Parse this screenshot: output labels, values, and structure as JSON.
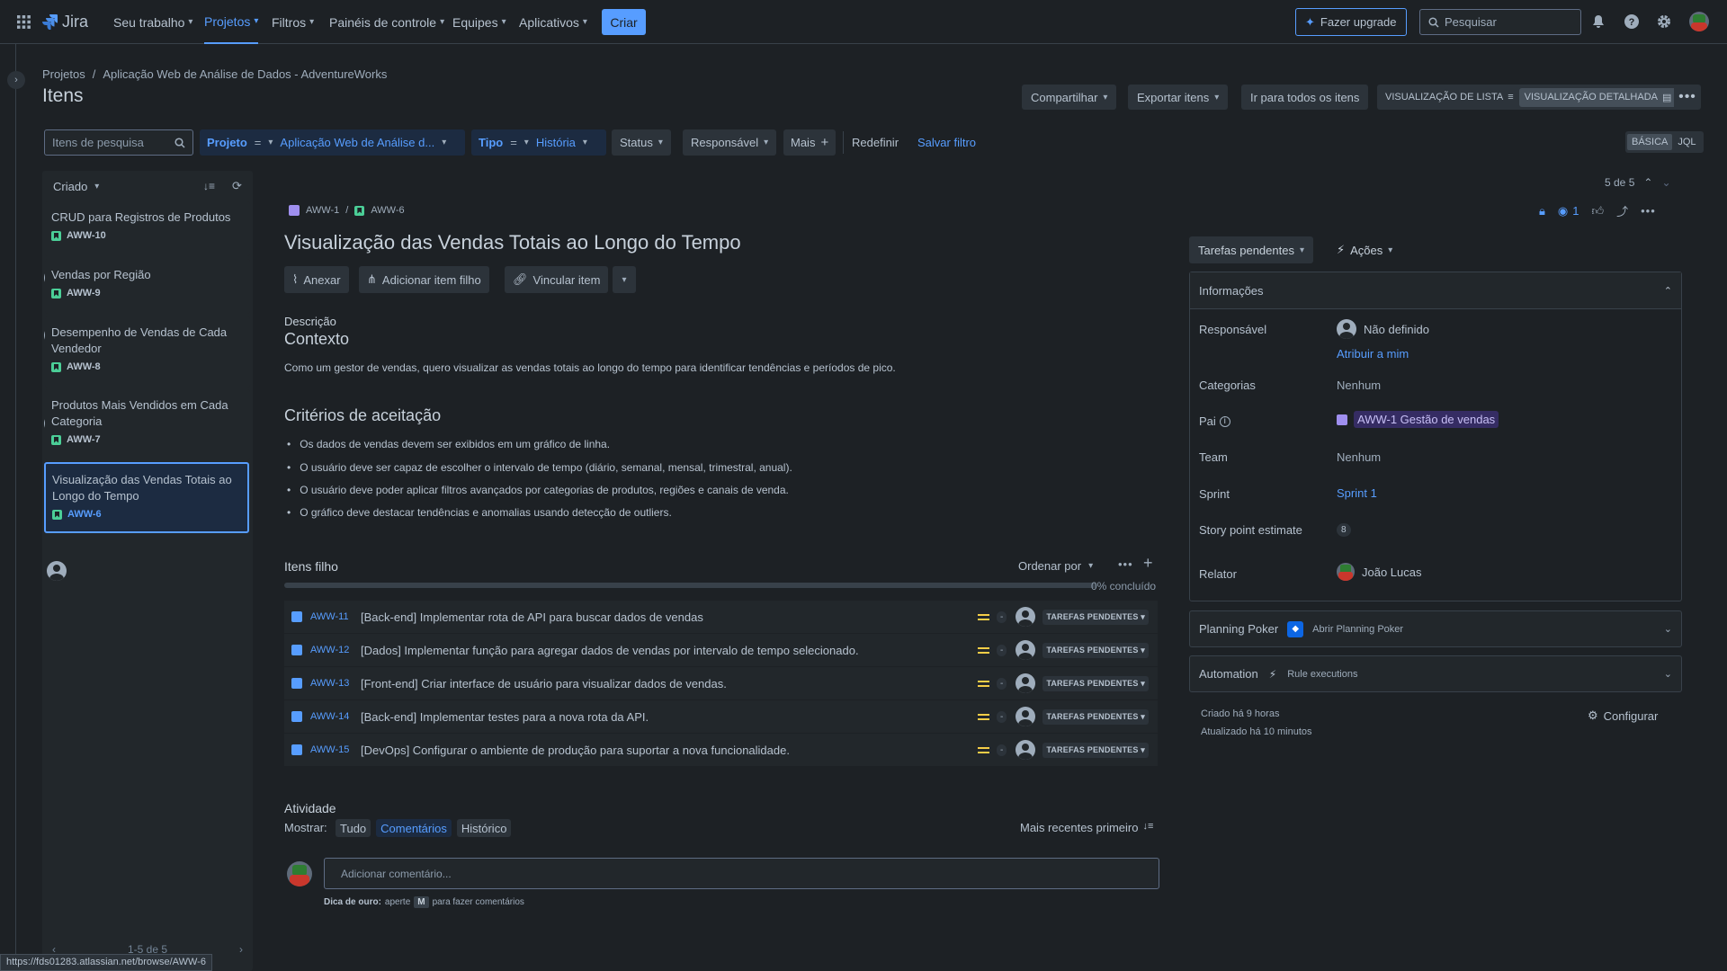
{
  "nav": {
    "app": "Jira",
    "items": [
      "Seu trabalho",
      "Projetos",
      "Filtros",
      "Painéis de controle",
      "Equipes",
      "Aplicativos"
    ],
    "create": "Criar",
    "upgrade": "Fazer upgrade",
    "search_placeholder": "Pesquisar"
  },
  "breadcrumb": {
    "root": "Projetos",
    "sep": "/",
    "project": "Aplicação Web de Análise de Dados - AdventureWorks"
  },
  "page_title": "Itens",
  "toolbar": {
    "share": "Compartilhar",
    "export": "Exportar itens",
    "go_all": "Ir para todos os itens",
    "list_view": "VISUALIZAÇÃO DE LISTA",
    "detail_view": "VISUALIZAÇÃO DETALHADA"
  },
  "filters": {
    "search_placeholder": "Itens de pesquisa",
    "project_label": "Projeto",
    "project_op": "=",
    "project_value": "Aplicação Web de Análise d...",
    "type_label": "Tipo",
    "type_op": "=",
    "type_value": "História",
    "status": "Status",
    "assignee": "Responsável",
    "more": "Mais",
    "reset": "Redefinir",
    "save": "Salvar filtro",
    "basic": "BÁSICA",
    "jql": "JQL"
  },
  "list": {
    "sort": "Criado",
    "items": [
      {
        "title": "CRUD para Registros de Produtos",
        "key": "AWW-10"
      },
      {
        "title": "Vendas por Região",
        "key": "AWW-9"
      },
      {
        "title": "Desempenho de Vendas de Cada Vendedor",
        "key": "AWW-8"
      },
      {
        "title": "Produtos Mais Vendidos em Cada Categoria",
        "key": "AWW-7"
      },
      {
        "title": "Visualização das Vendas Totais ao Longo do Tempo",
        "key": "AWW-6"
      }
    ],
    "pagination": "1-5 de 5"
  },
  "detail": {
    "counter": "5 de 5",
    "parent_key": "AWW-1",
    "sep": "/",
    "key": "AWW-6",
    "watchers": "1",
    "title": "Visualização das Vendas Totais ao Longo do Tempo",
    "attach": "Anexar",
    "add_child": "Adicionar item filho",
    "link": "Vincular item",
    "desc_label": "Descrição",
    "context_heading": "Contexto",
    "context_text": "Como um gestor de vendas, quero visualizar as vendas totais ao longo do tempo para identificar tendências e períodos de pico.",
    "criteria_heading": "Critérios de aceitação",
    "criteria": [
      "Os dados de vendas devem ser exibidos em um gráfico de linha.",
      "O usuário deve ser capaz de escolher o intervalo de tempo (diário, semanal, mensal, trimestral, anual).",
      "O usuário deve poder aplicar filtros avançados por categorias de produtos, regiões e canais de venda.",
      "O gráfico deve destacar tendências e anomalias usando detecção de outliers."
    ],
    "children_heading": "Itens filho",
    "order_by": "Ordenar por",
    "progress_text": "0% concluído",
    "progress": 0,
    "children": [
      {
        "key": "AWW-11",
        "summary": "[Back-end] Implementar rota de API para buscar dados de vendas",
        "status": "TAREFAS PENDENTES"
      },
      {
        "key": "AWW-12",
        "summary": "[Dados] Implementar função para agregar dados de vendas por intervalo de tempo selecionado.",
        "status": "TAREFAS PENDENTES"
      },
      {
        "key": "AWW-13",
        "summary": "[Front-end] Criar interface de usuário para visualizar dados de vendas.",
        "status": "TAREFAS PENDENTES"
      },
      {
        "key": "AWW-14",
        "summary": "[Back-end] Implementar testes para a nova rota da API.",
        "status": "TAREFAS PENDENTES"
      },
      {
        "key": "AWW-15",
        "summary": "[DevOps] Configurar o ambiente de produção para suportar a nova funcionalidade.",
        "status": "TAREFAS PENDENTES"
      }
    ],
    "dash": "-",
    "activity_heading": "Atividade",
    "show_label": "Mostrar:",
    "tabs": [
      "Tudo",
      "Comentários",
      "Histórico"
    ],
    "newest": "Mais recentes primeiro",
    "comment_placeholder": "Adicionar comentário...",
    "tip_bold": "Dica de ouro:",
    "tip_press": "aperte",
    "tip_key": "M",
    "tip_rest": "para fazer comentários"
  },
  "side": {
    "status": "Tarefas pendentes",
    "actions": "Ações",
    "info_heading": "Informações",
    "assignee_label": "Responsável",
    "assignee_value": "Não definido",
    "assign_me": "Atribuir a mim",
    "categories_label": "Categorias",
    "categories_value": "Nenhum",
    "parent_label": "Pai",
    "parent_value": "AWW-1 Gestão de vendas",
    "team_label": "Team",
    "team_value": "Nenhum",
    "sprint_label": "Sprint",
    "sprint_value": "Sprint 1",
    "sp_label": "Story point estimate",
    "sp_value": "8",
    "reporter_label": "Relator",
    "reporter_value": "João Lucas",
    "poker_label": "Planning Poker",
    "poker_value": "Abrir Planning Poker",
    "automation_label": "Automation",
    "automation_value": "Rule executions",
    "created": "Criado há 9 horas",
    "updated": "Atualizado há 10 minutos",
    "configure": "Configurar"
  },
  "status_url": "https://fds01283.atlassian.net/browse/AWW-6"
}
